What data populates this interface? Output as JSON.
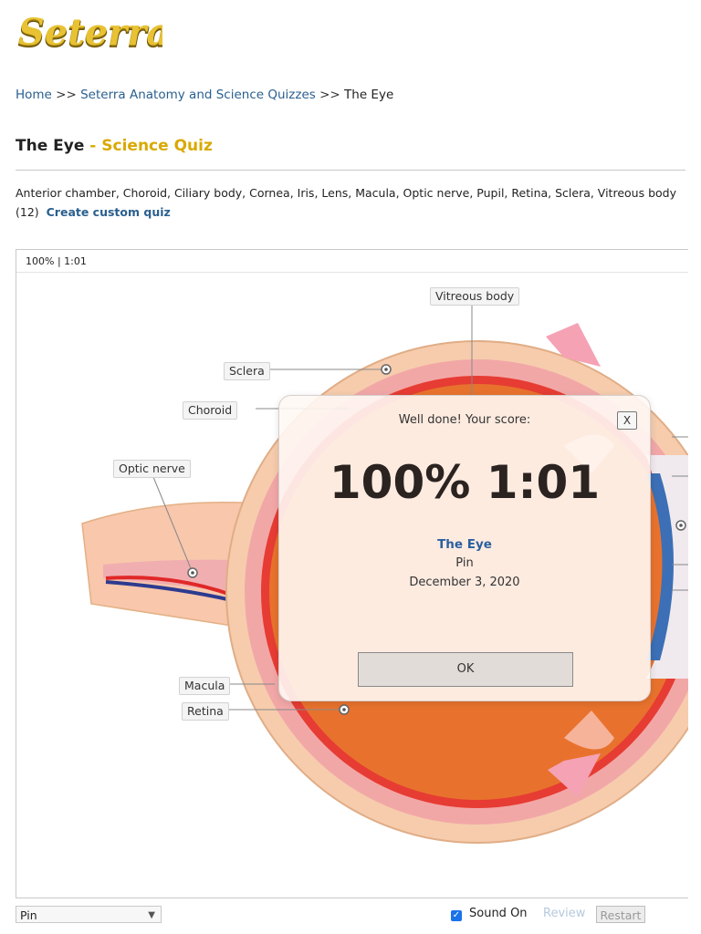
{
  "brand": {
    "logo_text": "Seterra"
  },
  "breadcrumb": {
    "home": "Home",
    "sep1": " >> ",
    "section": "Seterra Anatomy and Science Quizzes",
    "sep2": " >> ",
    "current": "The Eye"
  },
  "page": {
    "title": "The Eye",
    "subtitle": " - Science Quiz",
    "description": "Anterior chamber, Choroid, Ciliary body, Cornea, Iris, Lens, Macula, Optic nerve, Pupil, Retina, Sclera, Vitreous body (12)",
    "custom_link": "Create custom quiz"
  },
  "quiz": {
    "status": "100% | 1:01",
    "labels": {
      "vitreous": "Vitreous body",
      "sclera": "Sclera",
      "choroid": "Choroid",
      "optic": "Optic nerve",
      "macula": "Macula",
      "retina": "Retina"
    }
  },
  "result_modal": {
    "header": "Well done! Your score:",
    "close": "X",
    "score": "100% 1:01",
    "quiz_name": "The Eye",
    "mode": "Pin",
    "date": "December 3, 2020",
    "ok": "OK"
  },
  "controls": {
    "mode_select": "Pin",
    "sound_label": "Sound On",
    "sound_checked": true,
    "review": "Review",
    "restart": "Restart"
  },
  "colors": {
    "link": "#2a5f8f",
    "accent": "#d9a900",
    "score_text": "#2a2320",
    "quiz_name": "#2a5f9f",
    "checkbox": "#1a73e8"
  }
}
